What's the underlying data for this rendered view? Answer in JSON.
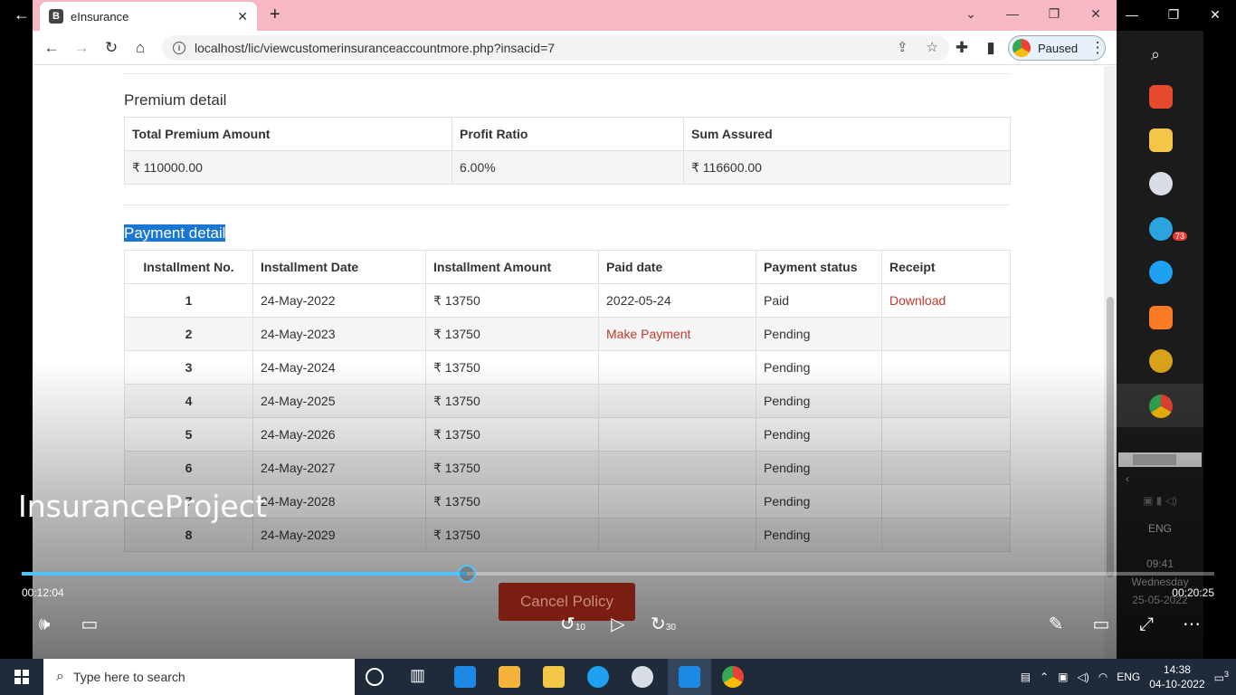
{
  "player": {
    "title": "InsuranceProject",
    "time_current": "00:12:04",
    "time_total": "00:20:25",
    "progress": 0.373,
    "skip_back": "10",
    "skip_forward": "30"
  },
  "browser": {
    "tab_title": "eInsurance",
    "tab_favicon": "B",
    "url": "localhost/lic/viewcustomerinsuranceaccountmore.php?insacid=7",
    "profile_status": "Paused"
  },
  "premium": {
    "heading": "Premium detail",
    "headers": [
      "Total Premium Amount",
      "Profit Ratio",
      "Sum Assured"
    ],
    "values": [
      "₹ 110000.00",
      "6.00%",
      "₹ 116600.00"
    ]
  },
  "payment": {
    "heading": "Payment detail",
    "headers": [
      "Installment No.",
      "Installment Date",
      "Installment Amount",
      "Paid date",
      "Payment status",
      "Receipt"
    ],
    "rows": [
      {
        "no": "1",
        "date": "24-May-2022",
        "amount": "₹ 13750",
        "paid": "2022-05-24",
        "status": "Paid",
        "receipt": "Download"
      },
      {
        "no": "2",
        "date": "24-May-2023",
        "amount": "₹ 13750",
        "paid": "Make Payment",
        "status": "Pending",
        "receipt": ""
      },
      {
        "no": "3",
        "date": "24-May-2024",
        "amount": "₹ 13750",
        "paid": "",
        "status": "Pending",
        "receipt": ""
      },
      {
        "no": "4",
        "date": "24-May-2025",
        "amount": "₹ 13750",
        "paid": "",
        "status": "Pending",
        "receipt": ""
      },
      {
        "no": "5",
        "date": "24-May-2026",
        "amount": "₹ 13750",
        "paid": "",
        "status": "Pending",
        "receipt": ""
      },
      {
        "no": "6",
        "date": "24-May-2027",
        "amount": "₹ 13750",
        "paid": "",
        "status": "Pending",
        "receipt": ""
      },
      {
        "no": "7",
        "date": "24-May-2028",
        "amount": "₹ 13750",
        "paid": "",
        "status": "Pending",
        "receipt": ""
      },
      {
        "no": "8",
        "date": "24-May-2029",
        "amount": "₹ 13750",
        "paid": "",
        "status": "Pending",
        "receipt": ""
      }
    ],
    "cancel_label": "Cancel Policy"
  },
  "side_panel": {
    "badge": "73",
    "lang": "ENG",
    "time": "09:41",
    "day": "Wednesday",
    "date": "25-05-2022"
  },
  "taskbar": {
    "search_placeholder": "Type here to search",
    "lang": "ENG",
    "time": "14:38",
    "date": "04-10-2022",
    "notifications": "3"
  },
  "colors": {
    "accent": "#4fc3f7",
    "link": "#c0392b",
    "selection": "#1976d2",
    "tabbar": "#f7b8c6"
  }
}
